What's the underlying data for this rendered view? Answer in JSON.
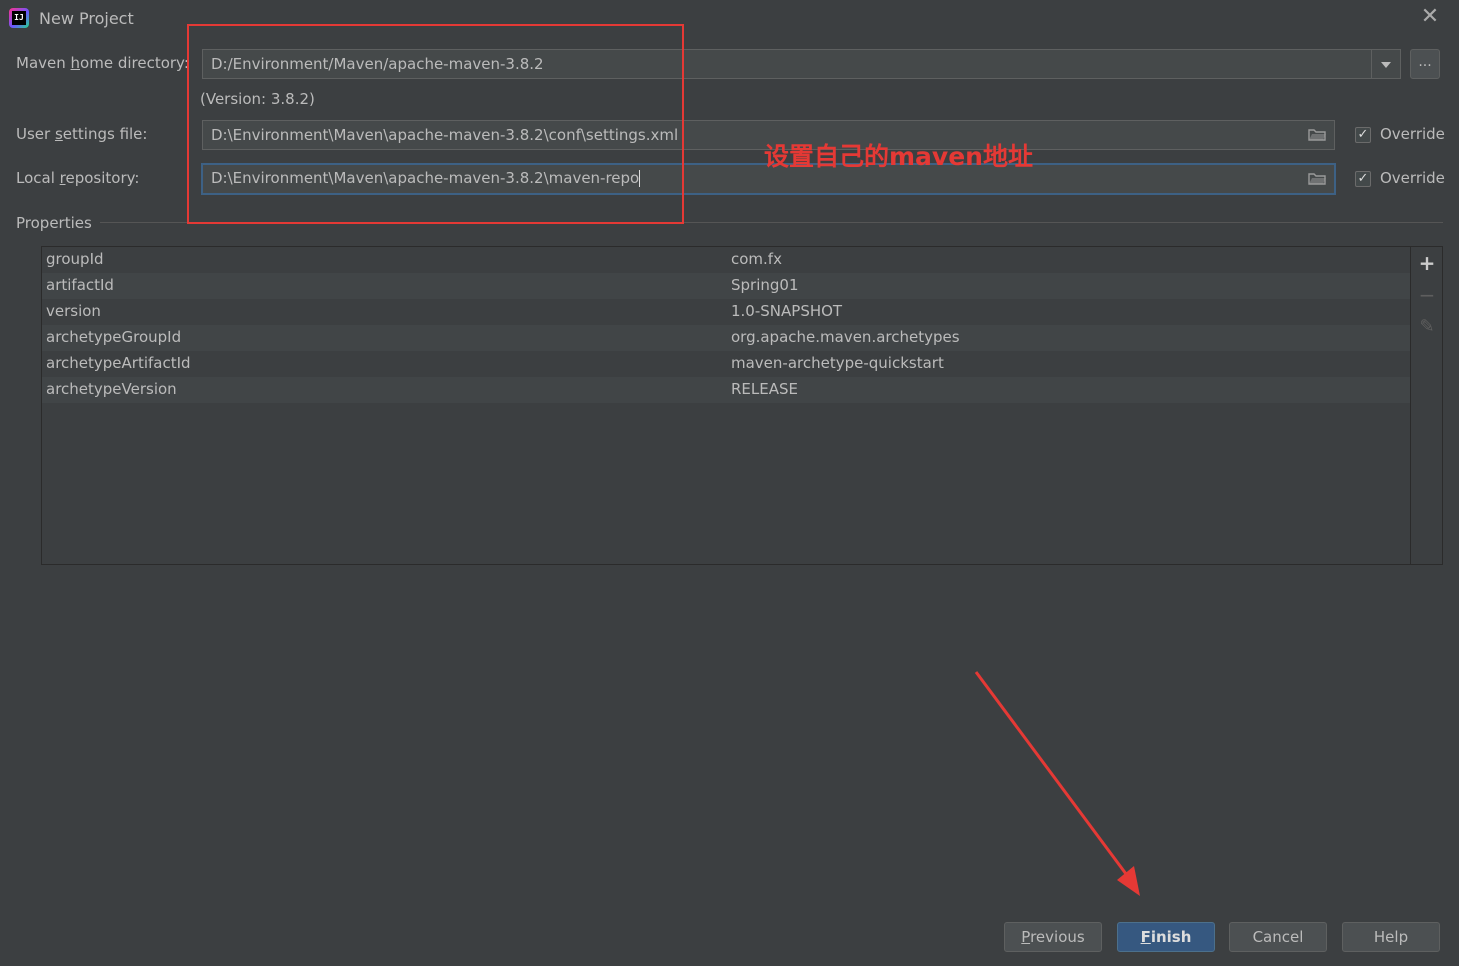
{
  "window": {
    "title": "New Project",
    "close_label": "✕"
  },
  "form": {
    "maven_home": {
      "label_pre": "Maven ",
      "label_u": "h",
      "label_post": "ome directory:",
      "value": "D:/Environment/Maven/apache-maven-3.8.2",
      "version_text": "(Version: 3.8.2)",
      "browse_label": "..."
    },
    "user_settings": {
      "label_pre": "User ",
      "label_u": "s",
      "label_post": "ettings file:",
      "value": "D:\\Environment\\Maven\\apache-maven-3.8.2\\conf\\settings.xml",
      "override_label": "Override",
      "override_checked": true
    },
    "local_repo": {
      "label_pre": "Local ",
      "label_u": "r",
      "label_post": "epository:",
      "value": "D:\\Environment\\Maven\\apache-maven-3.8.2\\maven-repo",
      "override_label": "Override",
      "override_checked": true
    }
  },
  "properties": {
    "title": "Properties",
    "rows": [
      {
        "key": "groupId",
        "value": "com.fx"
      },
      {
        "key": "artifactId",
        "value": "Spring01"
      },
      {
        "key": "version",
        "value": "1.0-SNAPSHOT"
      },
      {
        "key": "archetypeGroupId",
        "value": "org.apache.maven.archetypes"
      },
      {
        "key": "archetypeArtifactId",
        "value": "maven-archetype-quickstart"
      },
      {
        "key": "archetypeVersion",
        "value": "RELEASE"
      }
    ],
    "tools": {
      "add": "+",
      "remove": "−",
      "edit": "✎"
    }
  },
  "annotation": {
    "text": "设置自己的maven地址",
    "color": "#e53935"
  },
  "buttons": {
    "previous": {
      "u": "P",
      "rest": "revious"
    },
    "finish": {
      "u": "F",
      "rest": "inish"
    },
    "cancel": "Cancel",
    "help": "Help"
  },
  "colors": {
    "background": "#3c3f41",
    "accent": "#365880",
    "focus": "#3d6185"
  }
}
